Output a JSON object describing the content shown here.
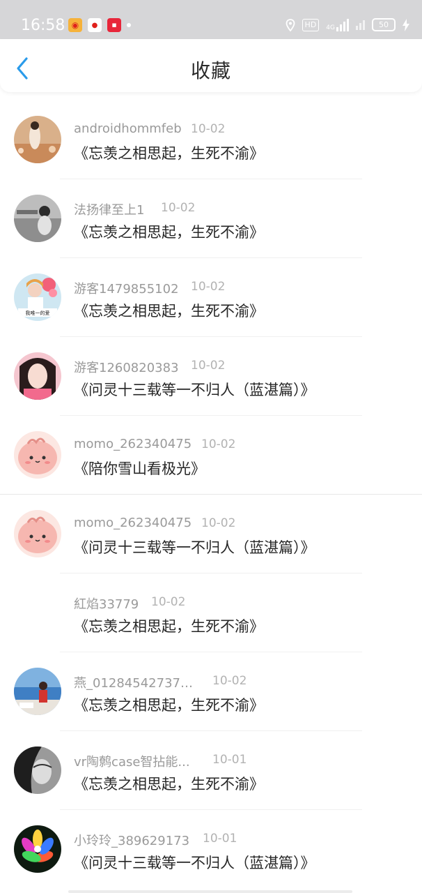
{
  "status_bar": {
    "time": "16:58",
    "hd": "HD",
    "network": "4G",
    "battery": "50",
    "icons": [
      "weibo-icon",
      "map-app-icon",
      "shop-app-icon",
      "location-icon",
      "signal-icon",
      "wifi-icon",
      "charging-icon"
    ]
  },
  "header": {
    "title": "收藏",
    "back_icon": "chevron-left-icon",
    "accent_color": "#2a9bea"
  },
  "items": [
    {
      "user": "androidhommfeb",
      "date": "10-02",
      "title": "《忘羡之相思起，生死不渝》"
    },
    {
      "user": "法扬律至上1",
      "date": "10-02",
      "title": "《忘羡之相思起，生死不渝》"
    },
    {
      "user": "游客1479855102",
      "date": "10-02",
      "title": "《忘羡之相思起，生死不渝》"
    },
    {
      "user": "游客1260820383",
      "date": "10-02",
      "title": "《问灵十三载等一不归人（蓝湛篇）》"
    },
    {
      "user": "momo_262340475",
      "date": "10-02",
      "title": "《陪你雪山看极光》"
    },
    {
      "user": "momo_262340475",
      "date": "10-02",
      "title": "《问灵十三载等一不归人（蓝湛篇）》"
    },
    {
      "user": "紅焰33779",
      "date": "10-02",
      "title": "《忘羡之相思起，生死不渝》"
    },
    {
      "user": "燕_012845427371...",
      "date": "10-02",
      "title": "《忘羡之相思起，生死不渝》"
    },
    {
      "user": "vr陶鹩case智拈能...",
      "date": "10-01",
      "title": "《忘羡之相思起，生死不渝》"
    },
    {
      "user": "小玲玲_389629173",
      "date": "10-01",
      "title": "《问灵十三载等一不归人（蓝湛篇）》"
    }
  ],
  "avatar_badge_text": "我唯一的爱"
}
